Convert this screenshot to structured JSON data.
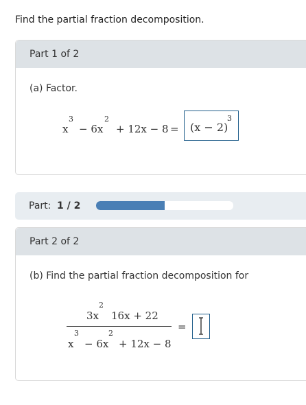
{
  "instructions": "Find the partial fraction decomposition.",
  "part1": {
    "header": "Part 1 of 2",
    "prompt": "(a) Factor.",
    "expr": {
      "x": "x",
      "x_exp": "3",
      "t2": "− 6x",
      "t2_exp": "2",
      "t3": "+ 12x − 8",
      "eq": "="
    },
    "answer": {
      "base": "(x − 2)",
      "exp": "3"
    }
  },
  "progress": {
    "label": "Part:",
    "value_text": "1 / 2",
    "fraction": 0.5
  },
  "part2": {
    "header": "Part 2 of 2",
    "prompt": "(b) Find the partial fraction decomposition for",
    "numerator": {
      "t1": "3x",
      "t1_exp": "2",
      "t2": "16x + 22"
    },
    "denominator": {
      "x": "x",
      "x_exp": "3",
      "t2": "− 6x",
      "t2_exp": "2",
      "t3": "+ 12x − 8"
    },
    "eq": "="
  },
  "colors": {
    "accent": "#4a7fb5",
    "header_bg": "#dde2e6",
    "box_border": "#1f5d8a"
  }
}
